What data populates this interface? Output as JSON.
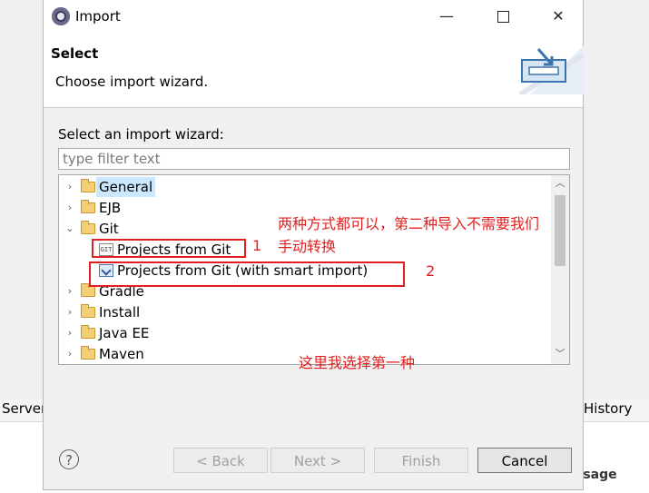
{
  "background": {
    "left_tab": "Server",
    "right_tab": "History",
    "message_label": "ssage"
  },
  "dialog": {
    "title": "Import",
    "banner_title": "Select",
    "banner_description": "Choose import wizard.",
    "prompt": "Select an import wizard:",
    "filter_placeholder": "type filter text",
    "filter_value": ""
  },
  "tree": {
    "items": [
      {
        "label": "General",
        "expanded": false,
        "selected": true,
        "icon": "folder-icon"
      },
      {
        "label": "EJB",
        "expanded": false,
        "icon": "folder-icon"
      },
      {
        "label": "Git",
        "expanded": true,
        "icon": "folder-icon"
      },
      {
        "label": "Projects from Git",
        "child": true,
        "icon": "git-icon"
      },
      {
        "label": "Projects from Git (with smart import)",
        "child": true,
        "icon": "smart-import-icon"
      },
      {
        "label": "Gradle",
        "expanded": false,
        "icon": "folder-icon"
      },
      {
        "label": "Install",
        "expanded": false,
        "icon": "folder-icon"
      },
      {
        "label": "Java EE",
        "expanded": false,
        "icon": "folder-icon"
      },
      {
        "label": "Maven",
        "expanded": false,
        "icon": "folder-icon"
      }
    ]
  },
  "annotations": {
    "note_line1": "两种方式都可以，第二种导入不需要我们",
    "note_line2": "手动转换",
    "marker_1": "1",
    "marker_2": "2",
    "choice_note": "这里我选择第一种",
    "color": "#e02020"
  },
  "buttons": {
    "back": "< Back",
    "next": "Next >",
    "finish": "Finish",
    "cancel": "Cancel",
    "help": "?"
  },
  "window_controls": {
    "minimize": "—",
    "close": "✕"
  }
}
